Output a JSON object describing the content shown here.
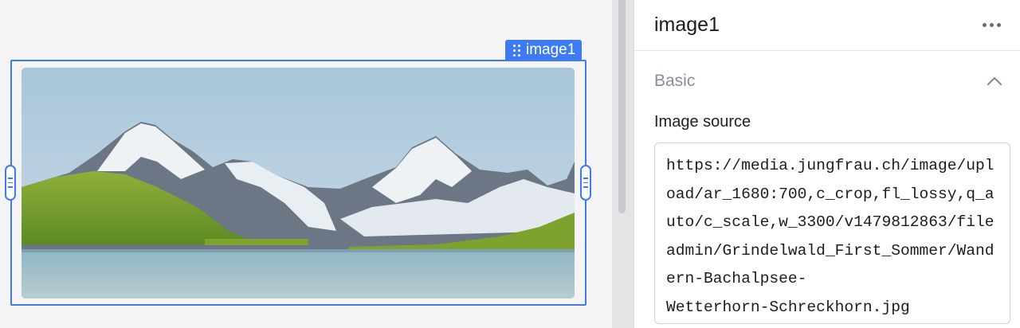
{
  "component": {
    "name_tag": "image1"
  },
  "panel": {
    "title": "image1",
    "more_icon": "more-horizontal-icon",
    "section": {
      "title": "Basic",
      "expanded": true,
      "chevron_icon": "chevron-up-icon"
    },
    "image_source": {
      "label": "Image source",
      "value": "https://media.jungfrau.ch/image/upload/ar_1680:700,c_crop,fl_lossy,q_auto/c_scale,w_3300/v1479812863/fileadmin/Grindelwald_First_Sommer/Wandern-Bachalpsee-\nWetterhorn-Schreckhorn.jpg"
    }
  },
  "colors": {
    "accent": "#3e7bf2",
    "canvas_bg": "#f4f4f4",
    "panel_bg": "#ffffff",
    "section_title": "#8a8ba3"
  }
}
